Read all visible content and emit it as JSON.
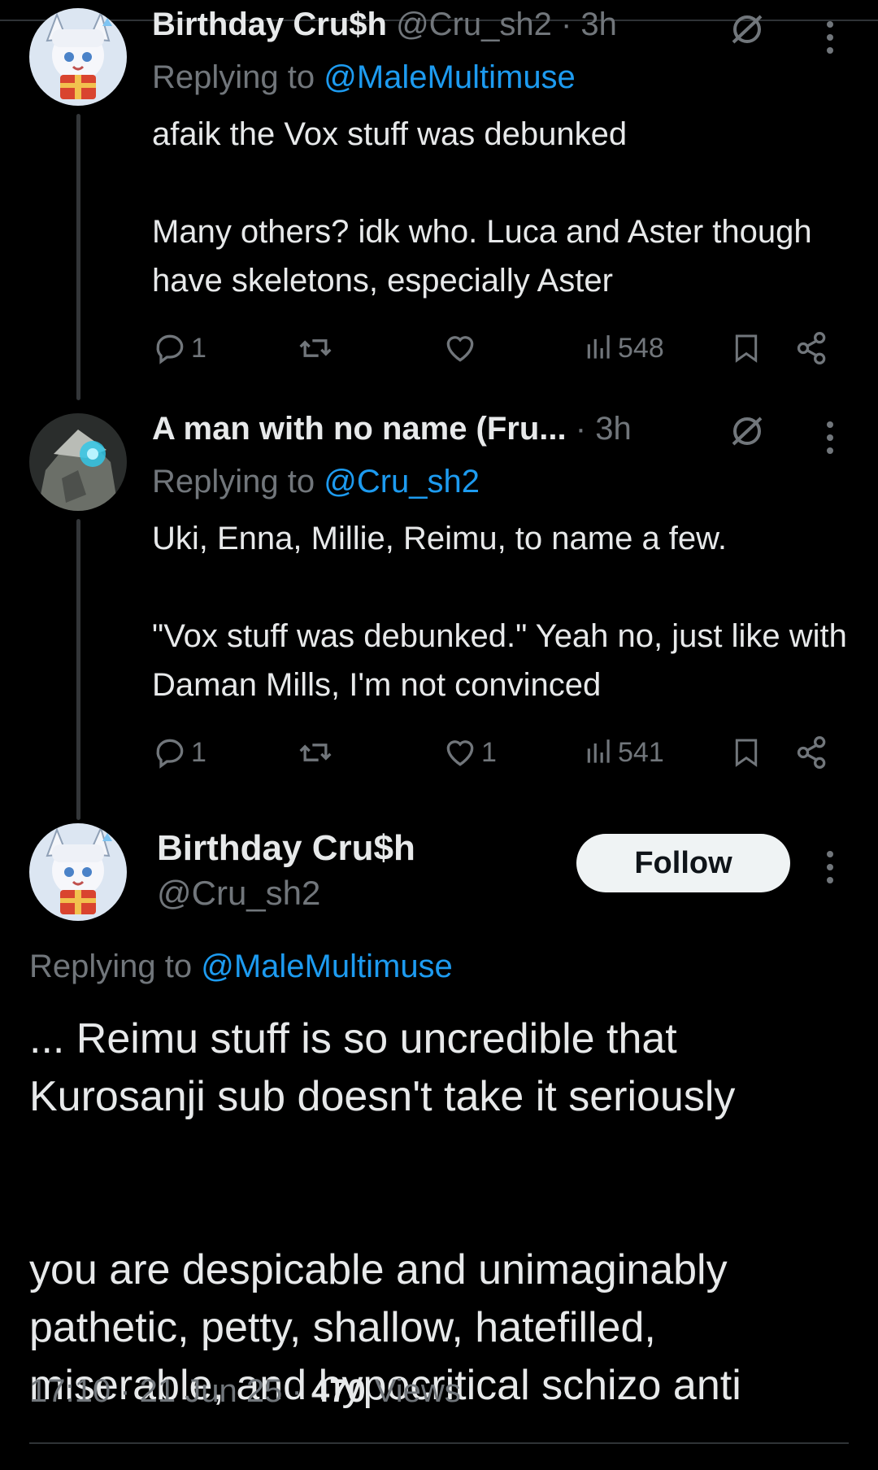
{
  "colors": {
    "background": "#000000",
    "text": "#e7e9ea",
    "muted": "#71767b",
    "link": "#1d9bf0",
    "follow_bg": "#eff3f4"
  },
  "tweets": [
    {
      "name": "Birthday Cru$h",
      "handle": "@Cru_sh2",
      "time": "3h",
      "replying_prefix": "Replying to ",
      "replying_to": "@MaleMultimuse",
      "body": "afaik the Vox stuff was debunked\n\nMany others? idk who. Luca and Aster though have skeletons, especially Aster",
      "replies": "1",
      "retweets": "",
      "likes": "",
      "views": "548",
      "icons": [
        "reply-icon",
        "retweet-icon",
        "like-icon",
        "views-icon",
        "bookmark-icon",
        "share-icon"
      ]
    },
    {
      "name": "A man with no name (Fru...",
      "time": "3h",
      "replying_prefix": "Replying to ",
      "replying_to": "@Cru_sh2",
      "body": "Uki, Enna, Millie, Reimu, to name a few.\n\n\"Vox stuff was debunked.\" Yeah no, just like with Daman Mills, I'm not convinced",
      "replies": "1",
      "retweets": "",
      "likes": "1",
      "views": "541"
    }
  ],
  "main_tweet": {
    "name": "Birthday Cru$h",
    "handle": "@Cru_sh2",
    "follow_label": "Follow",
    "replying_prefix": "Replying to ",
    "replying_to": "@MaleMultimuse",
    "body": "... Reimu stuff is so uncredible that Kurosanji sub doesn't take it seriously\n\n\nyou are despicable and unimaginably pathetic, petty, shallow, hatefilled, miserable, and hypocritical schizo anti",
    "time": "17:10",
    "date": "21 Jun 25",
    "views_count": "470",
    "views_label": "Views"
  }
}
